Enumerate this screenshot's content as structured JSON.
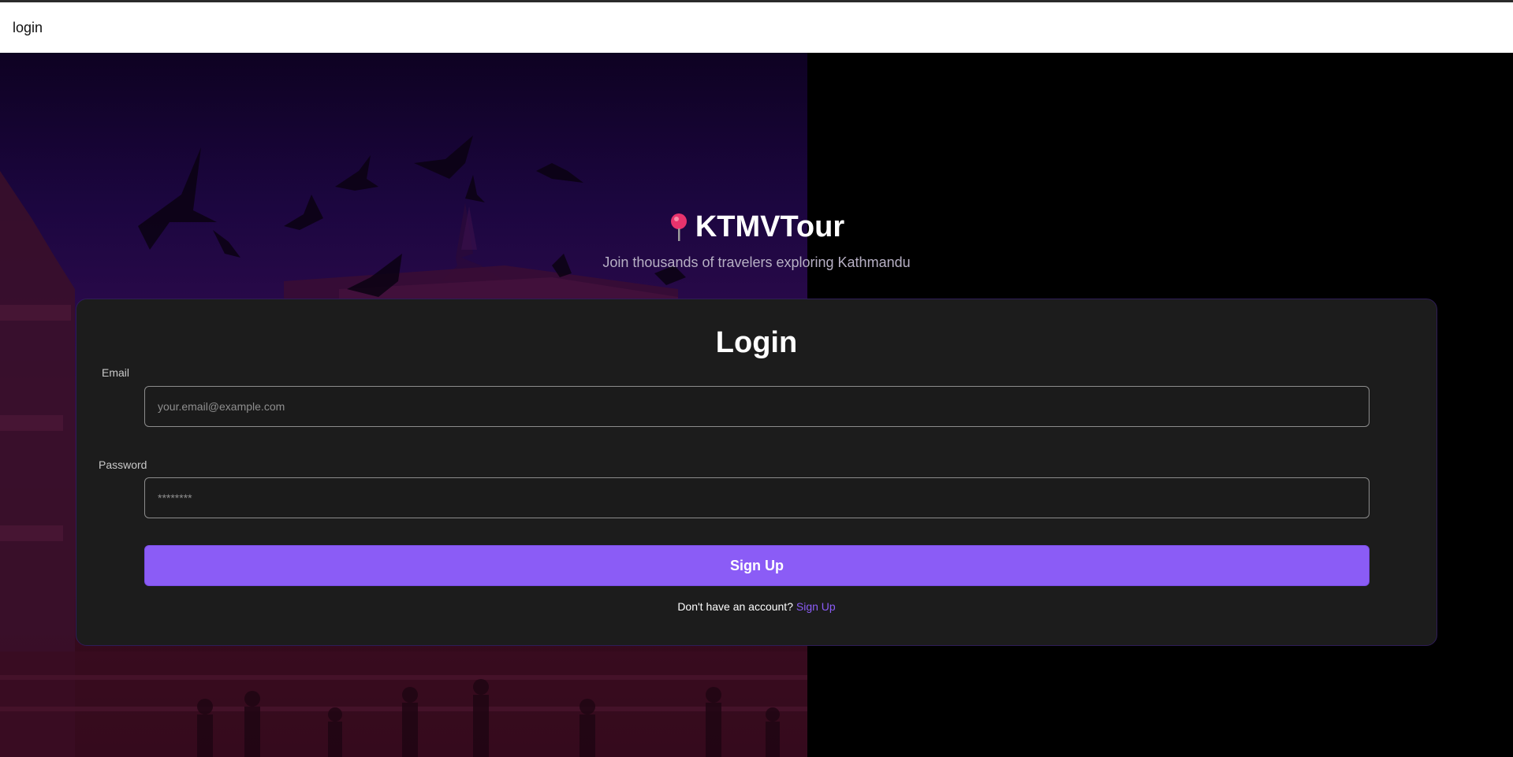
{
  "window": {
    "title": "login"
  },
  "brand": {
    "icon": "map-pin-icon",
    "name": "KTMVTour",
    "tagline": "Join thousands of travelers exploring Kathmandu"
  },
  "login_form": {
    "title": "Login",
    "email": {
      "label": "Email",
      "placeholder": "your.email@example.com",
      "value": ""
    },
    "password": {
      "label": "Password",
      "placeholder": "********",
      "value": ""
    },
    "submit_label": "Sign Up",
    "signup_prompt": "Don't have an account?",
    "signup_link": "Sign Up"
  },
  "colors": {
    "accent": "#8b5cf6",
    "card_background": "#1c1c1c",
    "page_background": "#000000",
    "pin": "#e8336d"
  }
}
